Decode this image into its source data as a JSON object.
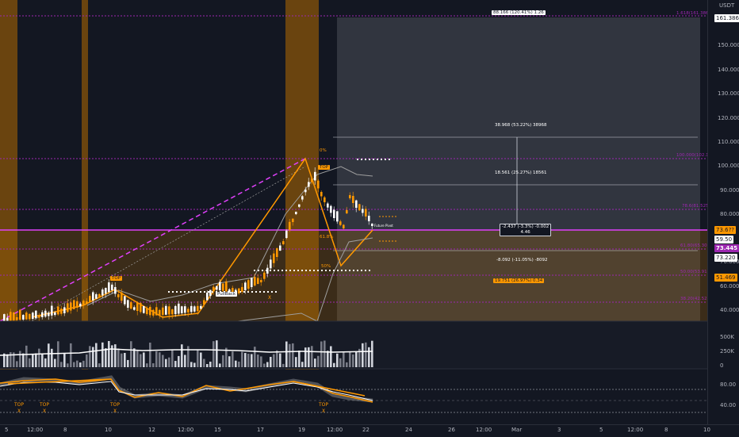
{
  "price_axis": {
    "currency": "USDT",
    "ticks": [
      "150.000",
      "140.000",
      "130.000",
      "120.000",
      "110.000",
      "100.000",
      "90.000",
      "80.000",
      "70.000",
      "60.000",
      "50.000",
      "40.000"
    ]
  },
  "volume_axis": {
    "ticks": [
      "500K",
      "250K",
      "0"
    ]
  },
  "rsi_axis": {
    "ticks": [
      "80.00",
      "40.00"
    ]
  },
  "time_axis": {
    "labels": [
      "5",
      "12:00",
      "8",
      "10",
      "12",
      "12:00",
      "15",
      "17",
      "19",
      "12:00",
      "22",
      "24",
      "26",
      "12:00",
      "Mar",
      "3",
      "5",
      "12:00",
      "8",
      "10"
    ]
  },
  "price_tags": [
    {
      "text": "161.386",
      "style": "white"
    },
    {
      "text": "73.6??",
      "style": "orange"
    },
    {
      "text": "59.50",
      "style": "white"
    },
    {
      "text": "73.445",
      "style": "purple"
    },
    {
      "text": "73.220",
      "style": "white"
    },
    {
      "text": "51.469",
      "style": "orange"
    }
  ],
  "fib_labels": [
    {
      "text": "1.618(161.386)"
    },
    {
      "text": "100.000(102.182)"
    },
    {
      "text": "78.6(81.525)"
    },
    {
      "text": "61.80(65.307)"
    },
    {
      "text": "50.00(53.917)"
    },
    {
      "text": "38.20(42.526)"
    }
  ],
  "measure": {
    "top_box": "88.166 (120.41%) 1.26",
    "up_label": "38.968 (53.22%) 38968",
    "mid_label": "18.561 (25.27%) 18561",
    "center_label_line1": "-2.437 (-3.3%) -0.002",
    "center_label_line2": "4.46",
    "down_label": "-8.092 (-11.05%) -8092",
    "orange_box": "19.751 (26.97%) 0.34"
  },
  "markers": {
    "top": "TOP",
    "pullback": "PullBack",
    "x": "X",
    "pct0": "0%",
    "fib618": "61.8%",
    "fib50": "50%",
    "small_label": "Future Pivot",
    "rsi_top_markers": [
      "TOP",
      "TOP",
      "TOP",
      "TOP"
    ]
  },
  "colors": {
    "background": "#131722",
    "bull": "#ffffff",
    "bear": "#ff9800",
    "purple": "#9c27b0",
    "magenta": "#e040fb",
    "orange_zone": "#b26a00",
    "grid": "#2a2e39"
  }
}
